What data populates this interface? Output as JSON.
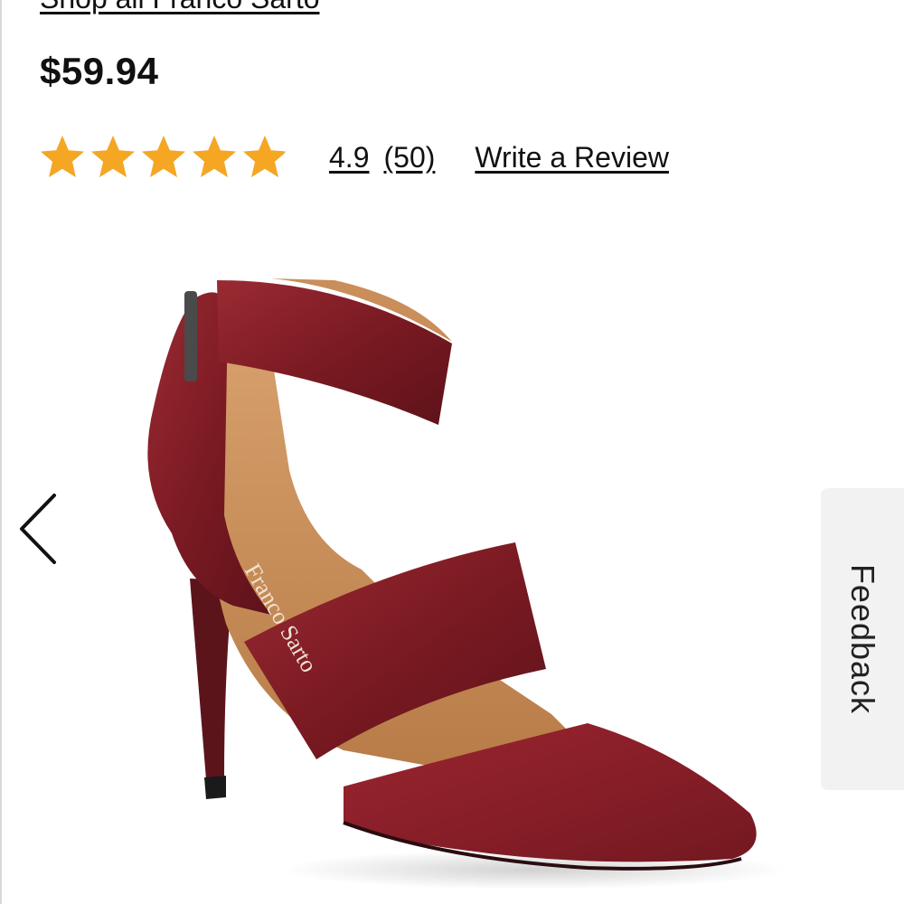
{
  "brand": {
    "shop_all_label": "Shop all Franco Sarto"
  },
  "product": {
    "price": "$59.94",
    "rating": {
      "value_label": "4.9",
      "count_label": "(50)",
      "stars_filled": 4.9,
      "stars_total": 5,
      "star_color": "#f5a623"
    },
    "write_review_label": "Write a Review",
    "image": {
      "subject": "burgundy pointed-toe pump with ankle strap and vamp strap",
      "insole_logo": "Franco Sarto",
      "colors": {
        "leather": "#7b1a22",
        "suede": "#8a1d24",
        "lining": "#c98e5a"
      }
    }
  },
  "carousel": {
    "prev_icon": "chevron-left-icon"
  },
  "feedback": {
    "label": "Feedback"
  }
}
